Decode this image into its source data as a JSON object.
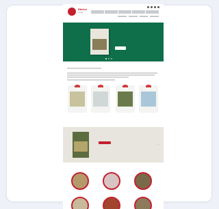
{
  "header": {
    "logo_text": "Bäcker",
    "logo_sub": "Verlag",
    "nav": [
      "",
      "",
      "",
      "",
      ""
    ],
    "icons": [
      "search-icon",
      "user-icon",
      "heart-icon",
      "cart-icon"
    ]
  },
  "hero": {
    "book_title": "",
    "title": "",
    "subtitle": "",
    "cta": ""
  },
  "intro": {
    "heading": "",
    "text": ""
  },
  "books": [
    {
      "title": ""
    },
    {
      "title": ""
    },
    {
      "title": ""
    },
    {
      "title": ""
    }
  ],
  "promo_section": {
    "label": "",
    "title": "",
    "text": "",
    "button": "",
    "arrow": "›"
  },
  "categories": {
    "label": "",
    "items": [
      {
        "label": ""
      },
      {
        "label": ""
      },
      {
        "label": ""
      },
      {
        "label": ""
      },
      {
        "label": ""
      },
      {
        "label": ""
      }
    ]
  },
  "colors": {
    "brand_red": "#c4202e",
    "hero_green": "#0f6f4a"
  }
}
